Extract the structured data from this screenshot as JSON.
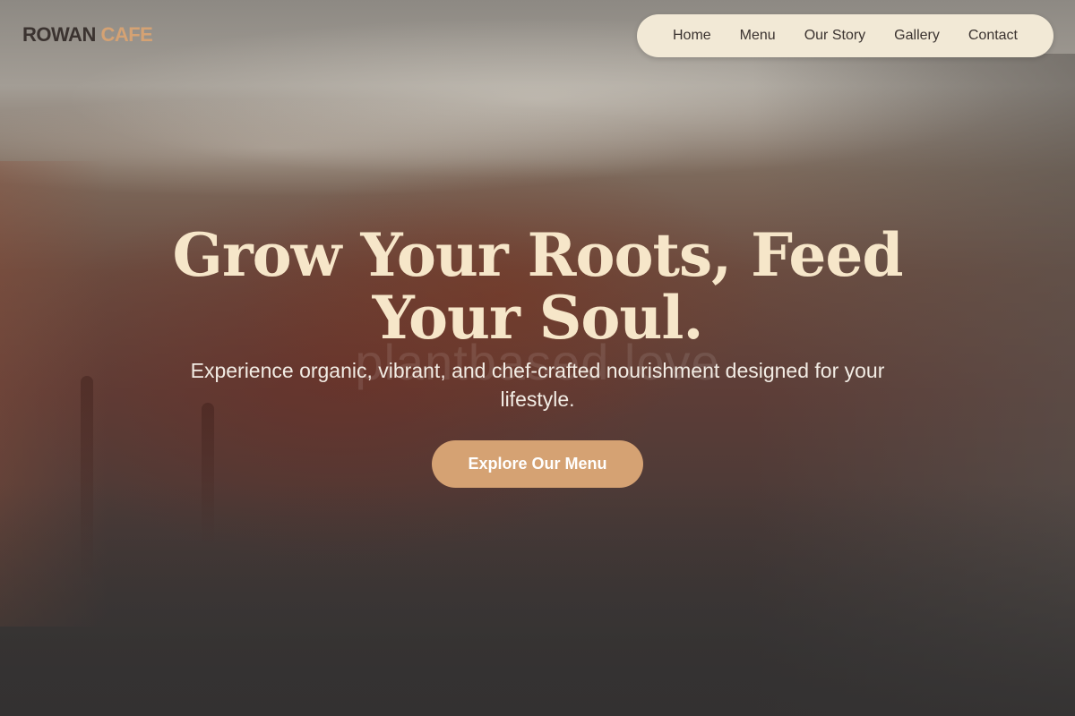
{
  "brand": {
    "name_part1": "ROWAN",
    "name_part2": "CAFE",
    "accent_color": "#d5a273",
    "dark_color": "#3b3330"
  },
  "nav": {
    "items": [
      {
        "label": "Home"
      },
      {
        "label": "Menu"
      },
      {
        "label": "Our Story"
      },
      {
        "label": "Gallery"
      },
      {
        "label": "Contact"
      }
    ],
    "background_color": "#f2e9d6"
  },
  "hero": {
    "watermark": "plantbased love",
    "title_line1": "Grow Your Roots, Feed",
    "title_line2": "Your Soul.",
    "title_color": "#f6e6c9",
    "subtitle": "Experience organic, vibrant, and chef-crafted nourishment designed for your lifestyle.",
    "cta_label": "Explore Our Menu"
  }
}
